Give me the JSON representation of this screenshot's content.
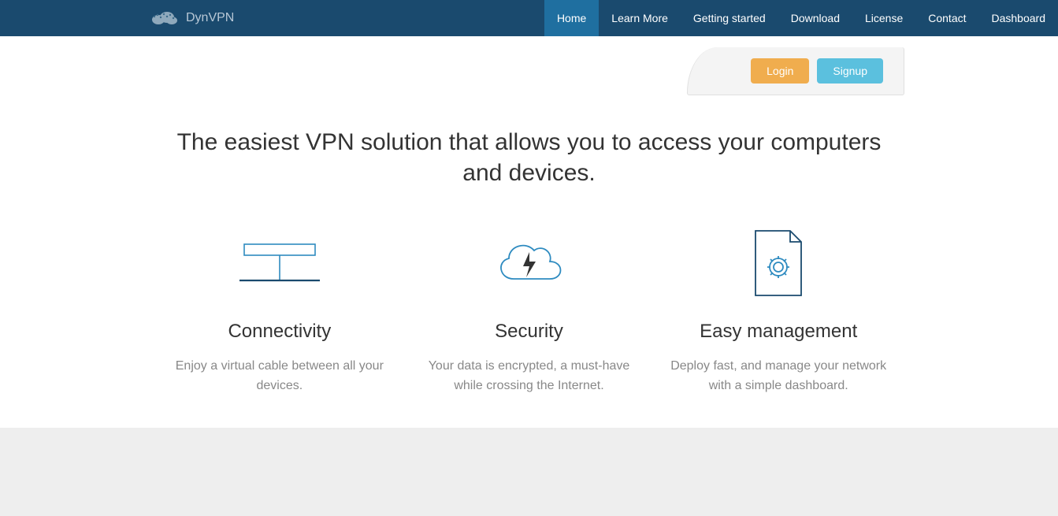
{
  "brand": "DynVPN",
  "nav": {
    "items": [
      "Home",
      "Learn More",
      "Getting started",
      "Download",
      "License",
      "Contact",
      "Dashboard"
    ]
  },
  "auth": {
    "login": "Login",
    "signup": "Signup"
  },
  "hero": {
    "title": "The easiest VPN solution that allows you to access your computers and devices."
  },
  "features": [
    {
      "title": "Connectivity",
      "desc": "Enjoy a virtual cable between all your devices."
    },
    {
      "title": "Security",
      "desc": "Your data is encrypted, a must-have while crossing the Internet."
    },
    {
      "title": "Easy management",
      "desc": "Deploy fast, and manage your network with a simple dashboard."
    }
  ]
}
